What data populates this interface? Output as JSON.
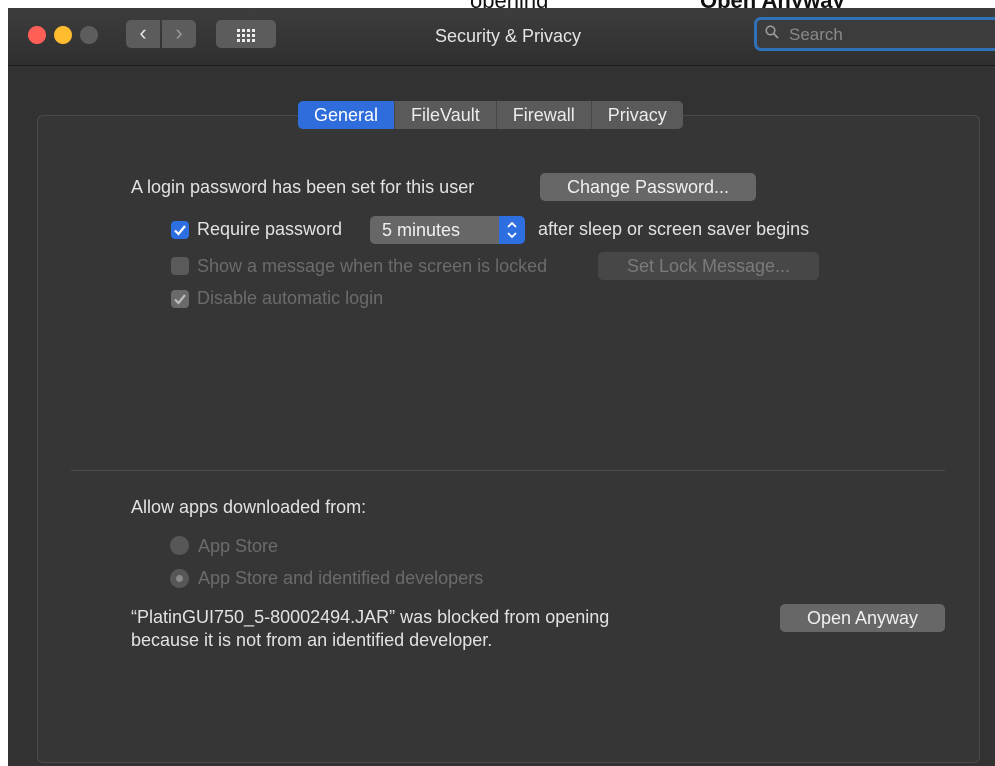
{
  "window": {
    "title": "Security & Privacy",
    "search_placeholder": "Search",
    "accent": "#2e6ddb",
    "top_crop": {
      "text_left": "opening",
      "text_right": "Open Anyway"
    }
  },
  "tabs": [
    {
      "label": "General",
      "selected": true
    },
    {
      "label": "FileVault",
      "selected": false
    },
    {
      "label": "Firewall",
      "selected": false
    },
    {
      "label": "Privacy",
      "selected": false
    }
  ],
  "general": {
    "login_text": "A login password has been set for this user",
    "change_password": "Change Password...",
    "require_password": {
      "label": "Require password",
      "checked": true,
      "interval": "5 minutes",
      "suffix": "after sleep or screen saver begins"
    },
    "show_message": {
      "label": "Show a message when the screen is locked",
      "checked": false,
      "enabled": false,
      "button": "Set Lock Message..."
    },
    "disable_auto_login": {
      "label": "Disable automatic login",
      "checked": true,
      "enabled": false
    }
  },
  "allow_apps": {
    "heading": "Allow apps downloaded from:",
    "options": [
      {
        "label": "App Store",
        "selected": false
      },
      {
        "label": "App Store and identified developers",
        "selected": true
      }
    ],
    "blocked_line1": "“PlatinGUI750_5-80002494.JAR” was blocked from opening",
    "blocked_line2": "because it is not from an identified developer.",
    "open_anyway": "Open Anyway"
  }
}
